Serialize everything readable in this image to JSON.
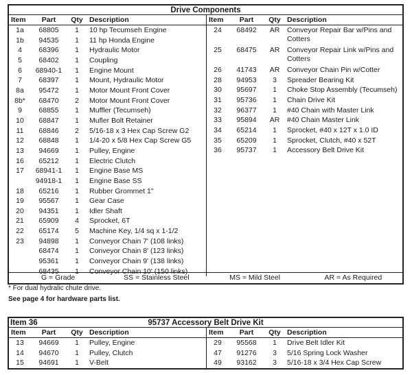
{
  "drive": {
    "title": "Drive Components",
    "headers": {
      "item": "Item",
      "part": "Part",
      "qty": "Qty",
      "desc": "Description"
    },
    "left": [
      [
        "1a",
        "68805",
        "1",
        "10 hp Tecumseh Engine"
      ],
      [
        "1b",
        "94535",
        "1",
        "11 hp Honda Engine"
      ],
      [
        "4",
        "68396",
        "1",
        "Hydraulic Motor"
      ],
      [
        "5",
        "68402",
        "1",
        "Coupling"
      ],
      [
        "6",
        "68940-1",
        "1",
        "Engine Mount"
      ],
      [
        "7",
        "68397",
        "1",
        "Mount, Hydraulic Motor"
      ],
      [
        "8a",
        "95472",
        "1",
        "Motor Mount Front Cover"
      ],
      [
        "8b*",
        "68470",
        "2",
        "Motor Mount Front Cover"
      ],
      [
        "9",
        "68855",
        "1",
        "Muffler (Tecumseh)"
      ],
      [
        "10",
        "68847",
        "1",
        "Mufler Bolt Retainer"
      ],
      [
        "11",
        "68846",
        "2",
        "5/16-18 x 3 Hex Cap Screw G2"
      ],
      [
        "12",
        "68848",
        "1",
        "1/4-20 x 5/8 Hex Cap Screw G5"
      ],
      [
        "13",
        "94669",
        "1",
        "Pulley, Engine"
      ],
      [
        "16",
        "65212",
        "1",
        "Electric Clutch"
      ],
      [
        "17",
        "68941-1",
        "1",
        "Engine Base MS"
      ],
      [
        "",
        "94918-1",
        "1",
        "Engine Base SS"
      ],
      [
        "18",
        "65216",
        "1",
        "Rubber Grommet 1\""
      ],
      [
        "19",
        "95567",
        "1",
        "Gear Case"
      ],
      [
        "20",
        "94351",
        "1",
        "Idler Shaft"
      ],
      [
        "21",
        "65909",
        "4",
        "Sprocket, 6T"
      ],
      [
        "22",
        "65174",
        "5",
        "Machine Key, 1/4 sq x 1-1/2"
      ],
      [
        "23",
        "94898",
        "1",
        "Conveyor Chain 7' (108 links)"
      ],
      [
        "",
        "68474",
        "1",
        "Conveyor Chain 8' (123 links)"
      ],
      [
        "",
        "95361",
        "1",
        "Conveyor Chain 9' (138 links)"
      ],
      [
        "",
        "68435",
        "1",
        "Conveyor Chain 10' (150 links)"
      ]
    ],
    "right": [
      [
        "24",
        "68492",
        "AR",
        "Conveyor Repair Bar w/Pins and Cotters"
      ],
      [
        "25",
        "68475",
        "AR",
        "Conveyor Repair Link w/Pins and Cotters"
      ],
      [
        "26",
        "41743",
        "AR",
        "Conveyor Chain Pin w/Cotter"
      ],
      [
        "28",
        "94953",
        "3",
        "Spreader Bearing Kit"
      ],
      [
        "30",
        "95697",
        "1",
        "Choke Stop Assembly (Tecumseh)"
      ],
      [
        "31",
        "95736",
        "1",
        "Chain Drive Kit"
      ],
      [
        "32",
        "96377",
        "1",
        "#40 Chain with Master Link"
      ],
      [
        "33",
        "95894",
        "AR",
        "#40 Chain Master Link"
      ],
      [
        "34",
        "65214",
        "1",
        "Sprocket, #40 x 12T x 1.0 ID"
      ],
      [
        "35",
        "65209",
        "1",
        "Sprocket, Clutch, #40 x 52T"
      ],
      [
        "36",
        "95737",
        "1",
        "Accessory Belt Drive Kit"
      ]
    ],
    "legend": [
      "G = Grade",
      "SS = Stainless Steel",
      "MS = Mild Steel",
      "AR = As Required"
    ]
  },
  "notes": {
    "footnote": "* For dual hydralic chute drive.",
    "see": "See page 4 for hardware parts list."
  },
  "kit": {
    "item_label": "Item 36",
    "title": "95737  Accessory Belt Drive Kit",
    "left": [
      [
        "13",
        "94669",
        "1",
        "Pulley, Engine"
      ],
      [
        "14",
        "94670",
        "1",
        "Pulley, Clutch"
      ],
      [
        "15",
        "94691",
        "1",
        "V-Belt"
      ]
    ],
    "right": [
      [
        "29",
        "95568",
        "1",
        "Drive Belt Idler Kit"
      ],
      [
        "47",
        "91276",
        "3",
        "5/16 Spring Lock Washer"
      ],
      [
        "49",
        "93162",
        "3",
        "5/16-18 x 3/4 Hex Cap Screw"
      ]
    ]
  }
}
